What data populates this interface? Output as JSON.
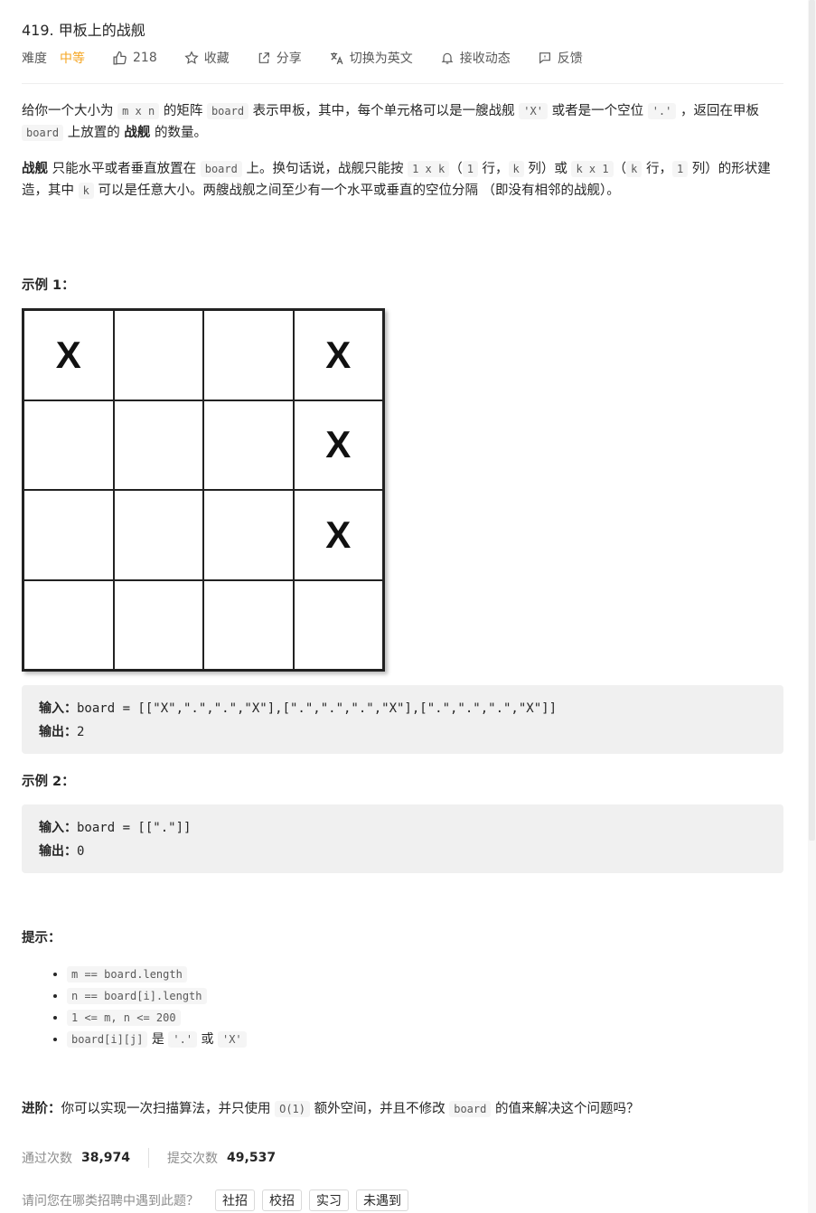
{
  "problem": {
    "title": "419. 甲板上的战舰",
    "difficulty_label": "难度",
    "difficulty_value": "中等",
    "likes": "218",
    "collect_label": "收藏",
    "share_label": "分享",
    "translate_label": "切换为英文",
    "subscribe_label": "接收动态",
    "feedback_label": "反馈"
  },
  "desc": {
    "p1_a": "给你一个大小为 ",
    "p1_code1": "m x n",
    "p1_b": " 的矩阵 ",
    "p1_code2": "board",
    "p1_c": " 表示甲板，其中，每个单元格可以是一艘战舰 ",
    "p1_code3": "'X'",
    "p1_d": " 或者是一个空位 ",
    "p1_code4": "'.'",
    "p1_e": " ，返回在甲板 ",
    "p1_code5": "board",
    "p1_f": " 上放置的 ",
    "p1_bold": "战舰",
    "p1_g": " 的数量。",
    "p2_bold": "战舰",
    "p2_a": " 只能水平或者垂直放置在 ",
    "p2_code1": "board",
    "p2_b": " 上。换句话说，战舰只能按 ",
    "p2_code2": "1 x k",
    "p2_c": "（",
    "p2_code3": "1",
    "p2_d": " 行，",
    "p2_code4": "k",
    "p2_e": " 列）或 ",
    "p2_code5": "k x 1",
    "p2_f": "（",
    "p2_code6": "k",
    "p2_g": " 行，",
    "p2_code7": "1",
    "p2_h": " 列）的形状建造，其中 ",
    "p2_code8": "k",
    "p2_i": " 可以是任意大小。两艘战舰之间至少有一个水平或垂直的空位分隔 （即没有相邻的战舰）。"
  },
  "example1": {
    "heading": "示例 1：",
    "board": [
      [
        "X",
        "",
        "",
        "X"
      ],
      [
        "",
        "",
        "",
        "X"
      ],
      [
        "",
        "",
        "",
        "X"
      ],
      [
        "",
        "",
        "",
        ""
      ]
    ],
    "input_label": "输入：",
    "input_value": "board = [[\"X\",\".\",\".\",\"X\"],[\".\",\".\",\".\",\"X\"],[\".\",\".\",\".\",\"X\"]]",
    "output_label": "输出：",
    "output_value": "2"
  },
  "example2": {
    "heading": "示例 2：",
    "input_label": "输入：",
    "input_value": "board = [[\".\"]]",
    "output_label": "输出：",
    "output_value": "0"
  },
  "hints": {
    "heading": "提示：",
    "h1": "m == board.length",
    "h2": "n == board[i].length",
    "h3": "1 <= m, n <= 200",
    "h4_code": "board[i][j]",
    "h4_a": " 是 ",
    "h4_code2": "'.'",
    "h4_b": " 或 ",
    "h4_code3": "'X'"
  },
  "advanced": {
    "label": "进阶：",
    "a": "你可以实现一次扫描算法，并只使用 ",
    "code1": "O(1)",
    "b": " 额外空间，并且不修改 ",
    "code2": "board",
    "c": " 的值来解决这个问题吗？"
  },
  "stats": {
    "accepted_label": "通过次数",
    "accepted_value": "38,974",
    "submitted_label": "提交次数",
    "submitted_value": "49,537"
  },
  "survey": {
    "question": "请问您在哪类招聘中遇到此题？",
    "opt1": "社招",
    "opt2": "校招",
    "opt3": "实习",
    "opt4": "未遇到"
  }
}
